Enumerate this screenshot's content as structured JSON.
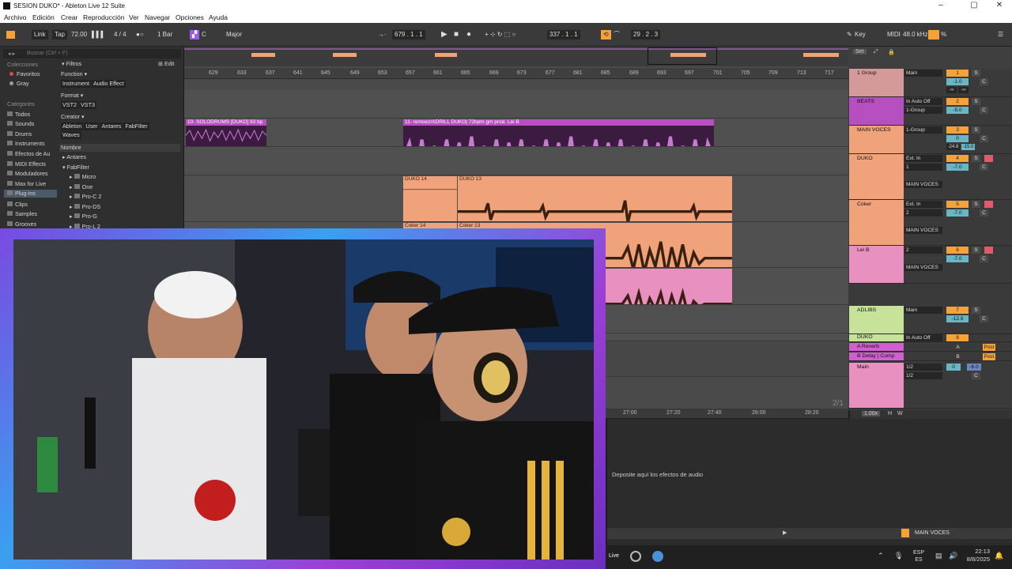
{
  "window": {
    "title": "SESION DUKO* - Ableton Live 12 Suite"
  },
  "menu": [
    "Archivo",
    "Edición",
    "Crear",
    "Reproducción",
    "Ver",
    "Navegar",
    "Opciones",
    "Ayuda"
  ],
  "control_bar": {
    "link": "Link",
    "tap": "Tap",
    "tempo": "72.00",
    "time_sig": "4 / 4",
    "quant": "1 Bar",
    "key_root": "C",
    "key_scale": "Major",
    "position": "679 .  1 .  1",
    "loop_start": "337 .  1 .  1",
    "loop_len": "29 .  2 .  3",
    "key_label": "Key",
    "midi_label": "MIDI",
    "sample_rate": "48.0 kHz",
    "cpu": "%"
  },
  "browser": {
    "search_placeholder": "Buscar (Ctrl + F)",
    "collections_header": "Colecciones",
    "collections": [
      {
        "label": "Favoritos",
        "color": "#e04848"
      },
      {
        "label": "Gray",
        "color": "#9a9a9a"
      }
    ],
    "categories_header": "Categories",
    "categories": [
      "Todos",
      "Sounds",
      "Drums",
      "Instruments",
      "Efectos de Au",
      "MIDI Effects",
      "Moduladores",
      "Max for Live",
      "Plug-ins",
      "Clips",
      "Samples",
      "Grooves"
    ],
    "filters_label": "Filtros",
    "edit_label": "Edit",
    "function_label": "Function",
    "function_tags": [
      "Instrument",
      "Audio Effect"
    ],
    "format_label": "Format",
    "format_tags": [
      "VST2",
      "VST3"
    ],
    "creator_label": "Creator",
    "creator_tags": [
      "Ableton",
      "User",
      "Antares",
      "FabFilter"
    ],
    "creator_tags2": [
      "Waves"
    ],
    "name_header": "Nombre",
    "tree": [
      "Antares",
      "FabFilter",
      "Micro",
      "One",
      "Pro-C 2",
      "Pro-DS",
      "Pro-G",
      "Pro-L 2"
    ]
  },
  "ruler_ticks": [
    "629",
    "633",
    "637",
    "641",
    "645",
    "649",
    "653",
    "657",
    "661",
    "665",
    "669",
    "673",
    "677",
    "681",
    "685",
    "689",
    "693",
    "697",
    "701",
    "705",
    "709",
    "713",
    "717"
  ],
  "clips": {
    "solodrums": "10- SOLODRUMS [DUKO] 83 bp",
    "remoez": "11- remoez/ADRILL DUKO| 72bpm gm prod. Lei B",
    "duko14": "DUKO 14",
    "duko13": "DUKO 13",
    "coker14": "Coker 14",
    "coker13": "Coker 13"
  },
  "mixer": {
    "set_label": "Set",
    "tracks": [
      {
        "name": "1 Group",
        "io": "Main",
        "num": "1",
        "vol": "-1.0",
        "pan": "C",
        "color": "#d49a9a"
      },
      {
        "name": "BEATS",
        "io": "In Auto Off",
        "io2": "1-Group",
        "num": "2",
        "vol": "-5.0",
        "pan": "C",
        "color": "#b84fc0"
      },
      {
        "name": "MAIN VOCES",
        "io": "1-Group",
        "num": "3",
        "vol": "0",
        "pan": "C",
        "inf_a": "-24.8",
        "inf_b": "-15.0",
        "color": "#f0a27a"
      },
      {
        "name": "DUKO",
        "io": "Ext. In",
        "io2": "1",
        "io3": "MAIN VOCES",
        "num": "4",
        "vol": "-7.0",
        "pan": "C",
        "color": "#f0a27a"
      },
      {
        "name": "Coker",
        "io": "Ext. In",
        "io2": "2",
        "io3": "MAIN VOCES",
        "num": "5",
        "vol": "-7.0",
        "pan": "C",
        "color": "#f0a27a"
      },
      {
        "name": "Lei B",
        "io": "2",
        "io3": "MAIN VOCES",
        "num": "6",
        "vol": "-7.0",
        "pan": "C",
        "color": "#e890c0"
      },
      {
        "name": "ADLIBS",
        "io": "Main",
        "num": "7",
        "vol": "-12.9",
        "pan": "C",
        "color": "#c7e39a"
      },
      {
        "name": "DUKO",
        "io": "In Auto Off",
        "num": "8",
        "vol": "",
        "pan": "C",
        "color": "#c7e39a"
      },
      {
        "name": "A Reverb",
        "num": "A",
        "color": "#d060d0"
      },
      {
        "name": "B Delay | Comp",
        "num": "B",
        "color": "#d060d0"
      },
      {
        "name": "Main",
        "io": "1/2",
        "io2": "1/2",
        "num": "0",
        "vol": "-6.0",
        "pan": "C",
        "color": "#e890c0"
      }
    ],
    "labels": {
      "in": "In",
      "auto": "Auto",
      "off": "Off",
      "s": "S",
      "c": "C",
      "post": "Post",
      "inf": "-∞"
    }
  },
  "arrange_bottom": {
    "ticks": [
      "27:00",
      "27:20",
      "27:40",
      "28:00",
      "28:20"
    ],
    "page": "2/1",
    "zoom": "1.00x",
    "h": "H",
    "w": "W"
  },
  "device_view": {
    "drop_text": "Deposite aquí los efectos de audio",
    "track_label": "MAIN VOCES"
  },
  "taskbar": {
    "lang": "ESP",
    "lang2": "ES",
    "time": "22:13",
    "date": "8/8/2025",
    "live": "Live"
  }
}
